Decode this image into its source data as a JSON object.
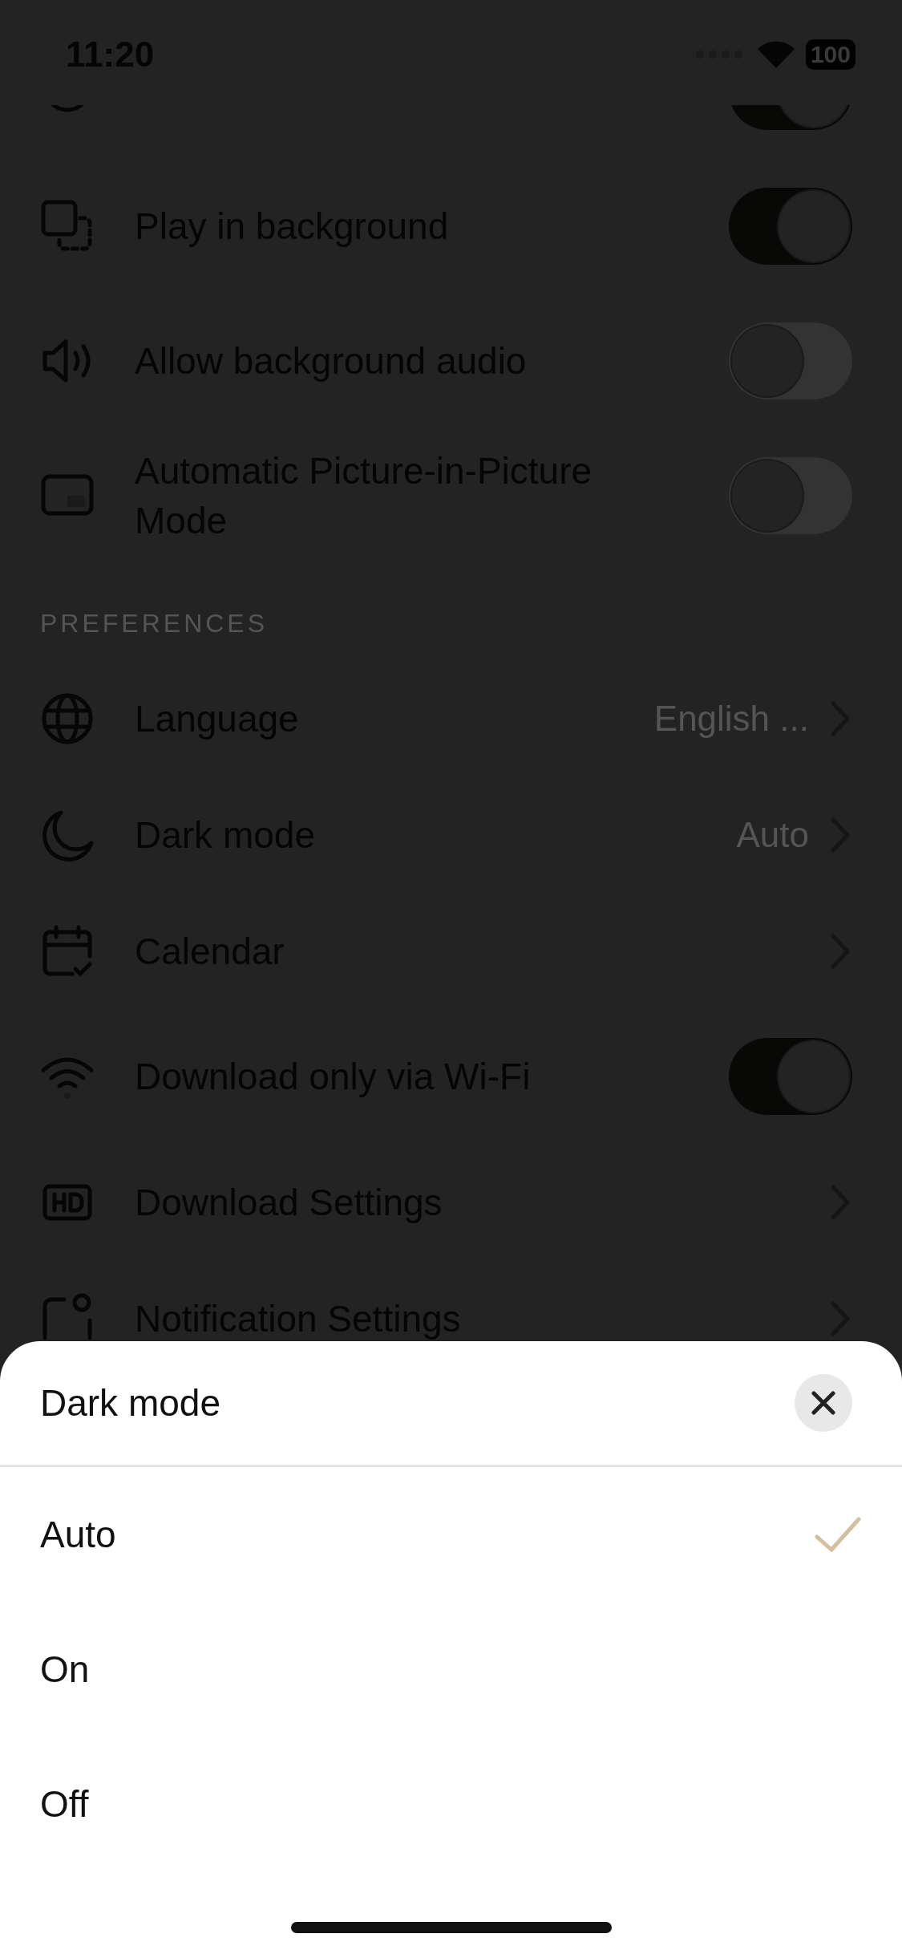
{
  "status_bar": {
    "time": "11:20",
    "battery": "100"
  },
  "sections": [
    {
      "items": [
        {
          "kind": "toggle",
          "on": true
        },
        {
          "kind": "toggle",
          "label": "Play in background",
          "on": true
        },
        {
          "kind": "toggle",
          "label": "Allow background audio",
          "on": false
        },
        {
          "kind": "toggle",
          "label": "Automatic Picture-in-Picture Mode",
          "on": false
        }
      ]
    },
    {
      "header": "PREFERENCES",
      "items": [
        {
          "kind": "link",
          "label": "Language",
          "value": "English ..."
        },
        {
          "kind": "link",
          "label": "Dark mode",
          "value": "Auto"
        },
        {
          "kind": "link",
          "label": "Calendar"
        },
        {
          "kind": "toggle",
          "label": "Download only via Wi-Fi",
          "on": true
        },
        {
          "kind": "link",
          "label": "Download Settings"
        },
        {
          "kind": "link",
          "label": "Notification Settings"
        }
      ]
    }
  ],
  "sheet": {
    "title": "Dark mode",
    "options": [
      {
        "label": "Auto",
        "selected": true
      },
      {
        "label": "On",
        "selected": false
      },
      {
        "label": "Off",
        "selected": false
      }
    ]
  }
}
